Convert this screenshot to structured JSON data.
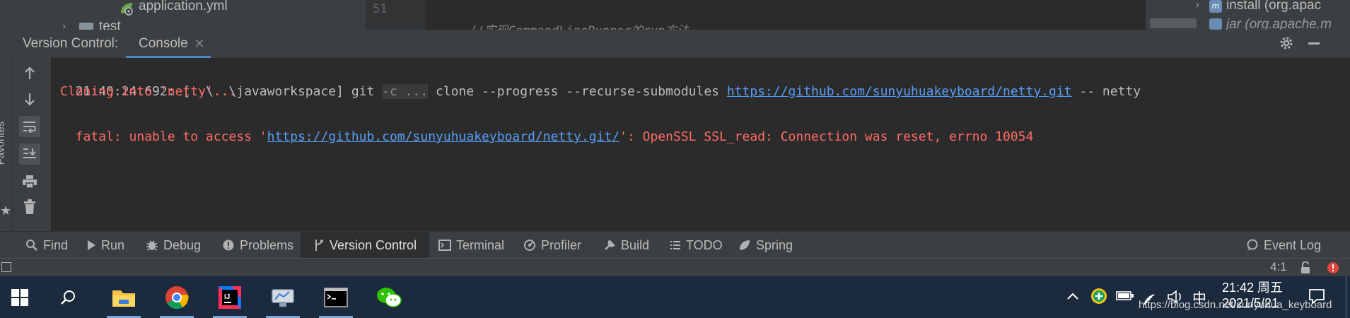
{
  "top": {
    "file_name": "application.yml",
    "folder_name": "test",
    "line_number": "51",
    "code_comment": "//实现CommandLineRunner的run方法",
    "maven_items": [
      "install (org.apac",
      "jar (org.apache.m"
    ]
  },
  "tool_window": {
    "title": "Version Control:",
    "tab_label": "Console",
    "close_glyph": "×"
  },
  "console": {
    "line1": {
      "prefix": "21:40:24.692: [..\\..\\javaworkspace] git ",
      "fold": "-c ...",
      "middle": " clone --progress --recurse-submodules ",
      "link": "https://github.com/sunyuhuakeyboard/netty.git",
      "suffix": " -- netty"
    },
    "line2": "Cloning into 'netty'...",
    "line3": {
      "prefix": "fatal: unable to access '",
      "link": "https://github.com/sunyuhuakeyboard/netty.git/",
      "suffix": "': OpenSSL SSL_read: Connection was reset, errno 10054"
    }
  },
  "side": {
    "favorites_label": "Favorites"
  },
  "bottom_tabs": [
    {
      "label": "Find",
      "icon": "search-icon"
    },
    {
      "label": "Run",
      "icon": "run-icon"
    },
    {
      "label": "Debug",
      "icon": "debug-icon"
    },
    {
      "label": "Problems",
      "icon": "problems-icon"
    },
    {
      "label": "Version Control",
      "icon": "vcs-icon"
    },
    {
      "label": "Terminal",
      "icon": "terminal-icon"
    },
    {
      "label": "Profiler",
      "icon": "profiler-icon"
    },
    {
      "label": "Build",
      "icon": "build-icon"
    },
    {
      "label": "TODO",
      "icon": "todo-icon"
    },
    {
      "label": "Spring",
      "icon": "spring-icon"
    },
    {
      "label": "Event Log",
      "icon": "event-log-icon"
    }
  ],
  "status": {
    "cursor_position": "4:1"
  },
  "taskbar": {
    "apps": [
      "file-explorer-icon",
      "chrome-icon",
      "intellij-icon",
      "network-app-icon",
      "cmd-icon",
      "wechat-icon"
    ],
    "ime_label": "中",
    "time": "21:42 周五",
    "date": "2021/5/21",
    "watermark": "https://blog.csdn.net/sunyuhua_keyboard"
  },
  "colors": {
    "accent_link": "#589df6",
    "error_text": "#ff6b68",
    "console_bg": "#2b2b2b",
    "panel_bg": "#3c3f41",
    "taskbar_bg": "#1c2a3d"
  }
}
